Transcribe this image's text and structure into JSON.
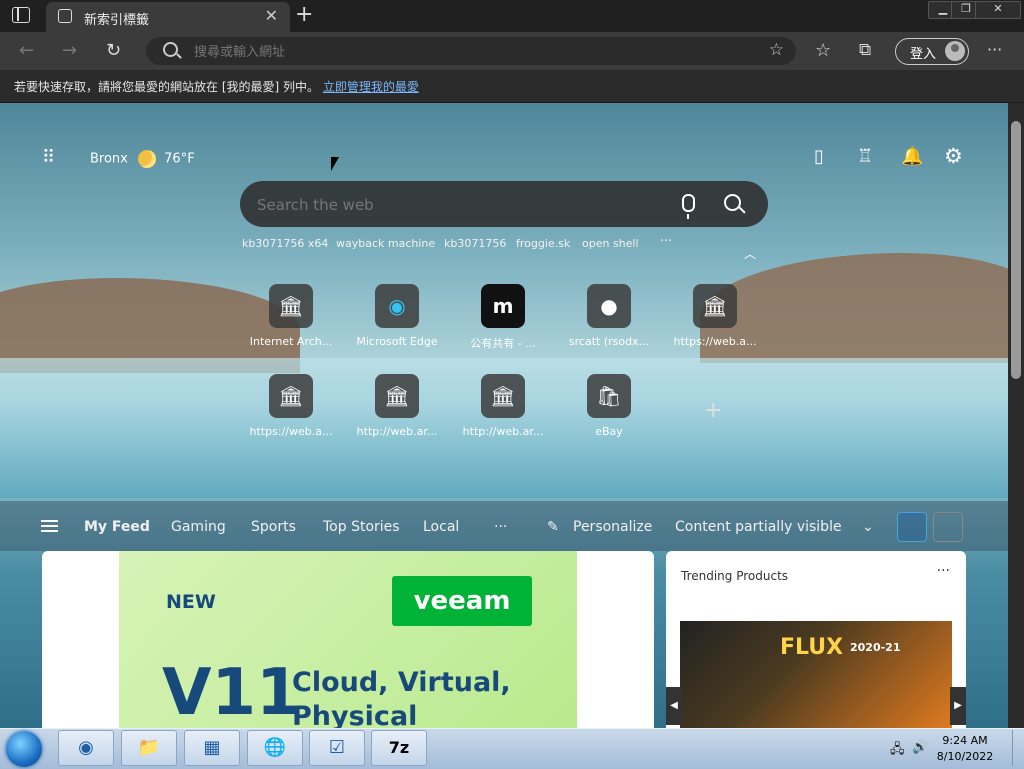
{
  "browser": {
    "tab_title": "新索引標籤",
    "tab_close": "✕",
    "new_tab": "+",
    "window_controls": [
      "▁",
      "❐",
      "✕"
    ]
  },
  "address_bar": {
    "placeholder": "搜尋或輸入網址",
    "signin_label": "登入"
  },
  "favorites_bar": {
    "message": "若要快速存取，請將您最愛的網站放在 [我的最愛] 列中。",
    "link": "立即管理我的最愛"
  },
  "ntp": {
    "weather": {
      "location": "Bronx",
      "temperature": "76°F"
    },
    "search": {
      "placeholder": "Search the web",
      "quick_links": [
        "kb3071756 x64",
        "wayback machine",
        "kb3071756",
        "froggie.sk",
        "open shell"
      ],
      "more": "···"
    },
    "tiles": [
      {
        "label": "Internet Arch...",
        "icon": "museum-icon",
        "glyph": "🏛"
      },
      {
        "label": "Microsoft Edge",
        "icon": "edge-icon",
        "glyph": "◉"
      },
      {
        "label": "公有共有 - ...",
        "icon": "m-logo-icon",
        "glyph": "m"
      },
      {
        "label": "srcatt (rsodx...",
        "icon": "github-icon",
        "glyph": "●"
      },
      {
        "label": "https://web.a...",
        "icon": "museum-icon",
        "glyph": "🏛"
      },
      {
        "label": "https://web.a...",
        "icon": "museum-icon",
        "glyph": "🏛"
      },
      {
        "label": "http://web.ar...",
        "icon": "museum-icon",
        "glyph": "🏛"
      },
      {
        "label": "http://web.ar...",
        "icon": "museum-icon",
        "glyph": "🏛"
      },
      {
        "label": "eBay",
        "icon": "shopping-bag-icon",
        "glyph": "🛍"
      }
    ],
    "add_tile": "+"
  },
  "feed": {
    "tabs": [
      "My Feed",
      "Gaming",
      "Sports",
      "Top Stories",
      "Local"
    ],
    "more": "···",
    "personalize": "Personalize",
    "visibility": "Content partially visible"
  },
  "cards": {
    "ad": {
      "badge": "NEW",
      "brand": "veeam",
      "big": "V11",
      "line1": "Cloud, Virtual,",
      "line2": "Physical"
    },
    "trending": {
      "title": "Trending Products",
      "menu": "···",
      "product_brand": "FLUX",
      "product_year": "2020-21"
    }
  },
  "taskbar": {
    "time": "9:24 AM",
    "date": "8/10/2022",
    "pinned": [
      "edge-icon",
      "explorer-icon",
      "control-panel-icon",
      "network-globe-icon",
      "task-manager-icon",
      "7zip-icon"
    ],
    "app_7zip": "7z"
  }
}
